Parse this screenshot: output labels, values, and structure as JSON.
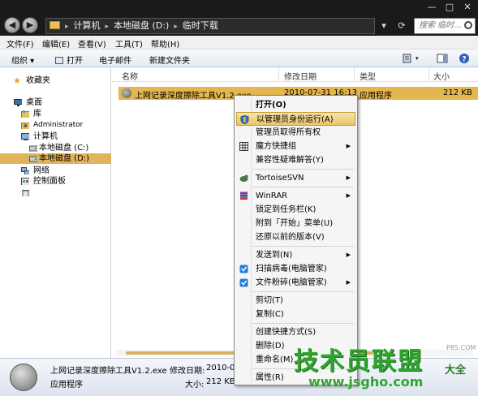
{
  "window": {
    "breadcrumb": [
      "计算机",
      "本地磁盘 (D:)",
      "临时下载"
    ],
    "search_placeholder": "搜索 临时...",
    "controls": {
      "minimize": "—",
      "maximize": "□",
      "close": "✕"
    },
    "refresh": "⟳"
  },
  "menubar": [
    "文件(F)",
    "编辑(E)",
    "查看(V)",
    "工具(T)",
    "帮助(H)"
  ],
  "toolbar": {
    "organize": "组织 ▾",
    "open": "打开",
    "email": "电子邮件",
    "new_folder": "新建文件夹"
  },
  "nav": {
    "favorites": "收藏夹",
    "desktop": "桌面",
    "libraries": "库",
    "administrator": "Administrator",
    "computer": "计算机",
    "drive_c": "本地磁盘 (C:)",
    "drive_d": "本地磁盘 (D:)",
    "network": "网络",
    "control_panel": "控制面板"
  },
  "columns": {
    "name": "名称",
    "modified": "修改日期",
    "type": "类型",
    "size": "大小"
  },
  "file": {
    "name": "上网记录深度擦除工具V1.2.exe",
    "modified": "2010-07-31 16:13",
    "type": "应用程序",
    "size": "212 KB"
  },
  "context_menu": [
    {
      "label": "打开(O)",
      "bold": true
    },
    {
      "label": "以管理员身份运行(A)",
      "highlight": true,
      "icon": "shield-icon"
    },
    {
      "label": "管理员取得所有权"
    },
    {
      "label": "魔方快捷组",
      "submenu": true,
      "icon": "grid-icon"
    },
    {
      "label": "兼容性疑难解答(Y)"
    },
    {
      "separator": true
    },
    {
      "label": "TortoiseSVN",
      "submenu": true,
      "icon": "tortoise-icon"
    },
    {
      "separator": true
    },
    {
      "label": "WinRAR",
      "submenu": true,
      "icon": "winrar-icon"
    },
    {
      "label": "锁定到任务栏(K)"
    },
    {
      "label": "附到「开始」菜单(U)"
    },
    {
      "label": "还原以前的版本(V)"
    },
    {
      "separator": true
    },
    {
      "label": "发送到(N)",
      "submenu": true
    },
    {
      "label": "扫描病毒(电脑管家)",
      "icon": "qq-guard-icon"
    },
    {
      "label": "文件粉碎(电脑管家)",
      "submenu": true,
      "icon": "qq-guard-icon"
    },
    {
      "separator": true
    },
    {
      "label": "剪切(T)"
    },
    {
      "label": "复制(C)"
    },
    {
      "separator": true
    },
    {
      "label": "创建快捷方式(S)"
    },
    {
      "label": "删除(D)"
    },
    {
      "label": "重命名(M)"
    },
    {
      "separator": true
    },
    {
      "label": "属性(R)"
    }
  ],
  "details": {
    "name": "上网记录深度擦除工具V1.2.exe",
    "modified_label": "修改日期:",
    "modified_value": "2010-07-",
    "type": "应用程序",
    "size_label": "大小:",
    "size_value": "212 KB"
  },
  "watermark": {
    "main": "技术员联盟",
    "url": "www.jsgho.com",
    "side": "大全",
    "small": "P85.COM"
  },
  "colors": {
    "highlight": "#e3b650",
    "menu_highlight": "#e9c46a",
    "watermark": "#2fa52f"
  }
}
